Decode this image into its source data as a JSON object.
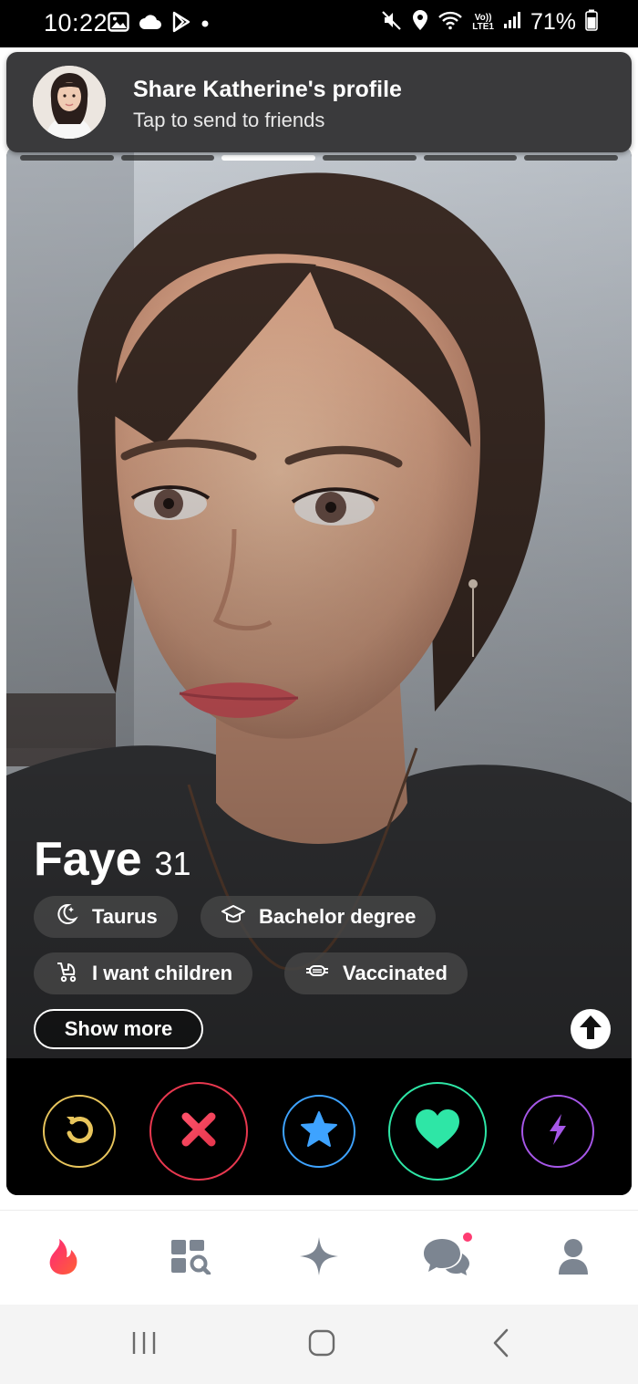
{
  "status_bar": {
    "time": "10:22",
    "battery": "71%",
    "network_top": "Vo))",
    "network_bottom": "LTE1"
  },
  "toast": {
    "title": "Share Katherine's profile",
    "subtitle": "Tap to send to friends"
  },
  "photo_progress": {
    "total": 6,
    "active_index": 2
  },
  "profile": {
    "name": "Faye",
    "age": "31",
    "chips": [
      {
        "icon": "moon-icon",
        "label": "Taurus"
      },
      {
        "icon": "graduation-cap-icon",
        "label": "Bachelor degree"
      },
      {
        "icon": "stroller-icon",
        "label": "I want children"
      },
      {
        "icon": "mask-icon",
        "label": "Vaccinated"
      }
    ],
    "show_more_label": "Show more"
  },
  "actions": [
    {
      "name": "rewind",
      "icon": "rewind-icon",
      "color": "#e8c55c"
    },
    {
      "name": "nope",
      "icon": "close-icon",
      "color": "#e8384f"
    },
    {
      "name": "super-like",
      "icon": "star-icon",
      "color": "#3ea3ff"
    },
    {
      "name": "like",
      "icon": "heart-icon",
      "color": "#2ee6a6"
    },
    {
      "name": "boost",
      "icon": "lightning-icon",
      "color": "#a657e8"
    }
  ],
  "bottom_nav": [
    {
      "name": "home",
      "icon": "flame-icon",
      "active": true
    },
    {
      "name": "explore",
      "icon": "explore-icon",
      "active": false
    },
    {
      "name": "gold",
      "icon": "sparkle-icon",
      "active": false
    },
    {
      "name": "messages",
      "icon": "chat-icon",
      "active": false,
      "has_notification": true
    },
    {
      "name": "profile",
      "icon": "user-icon",
      "active": false
    }
  ],
  "colors": {
    "brand": "#fe3c72",
    "nav_inactive": "#7c8591"
  }
}
